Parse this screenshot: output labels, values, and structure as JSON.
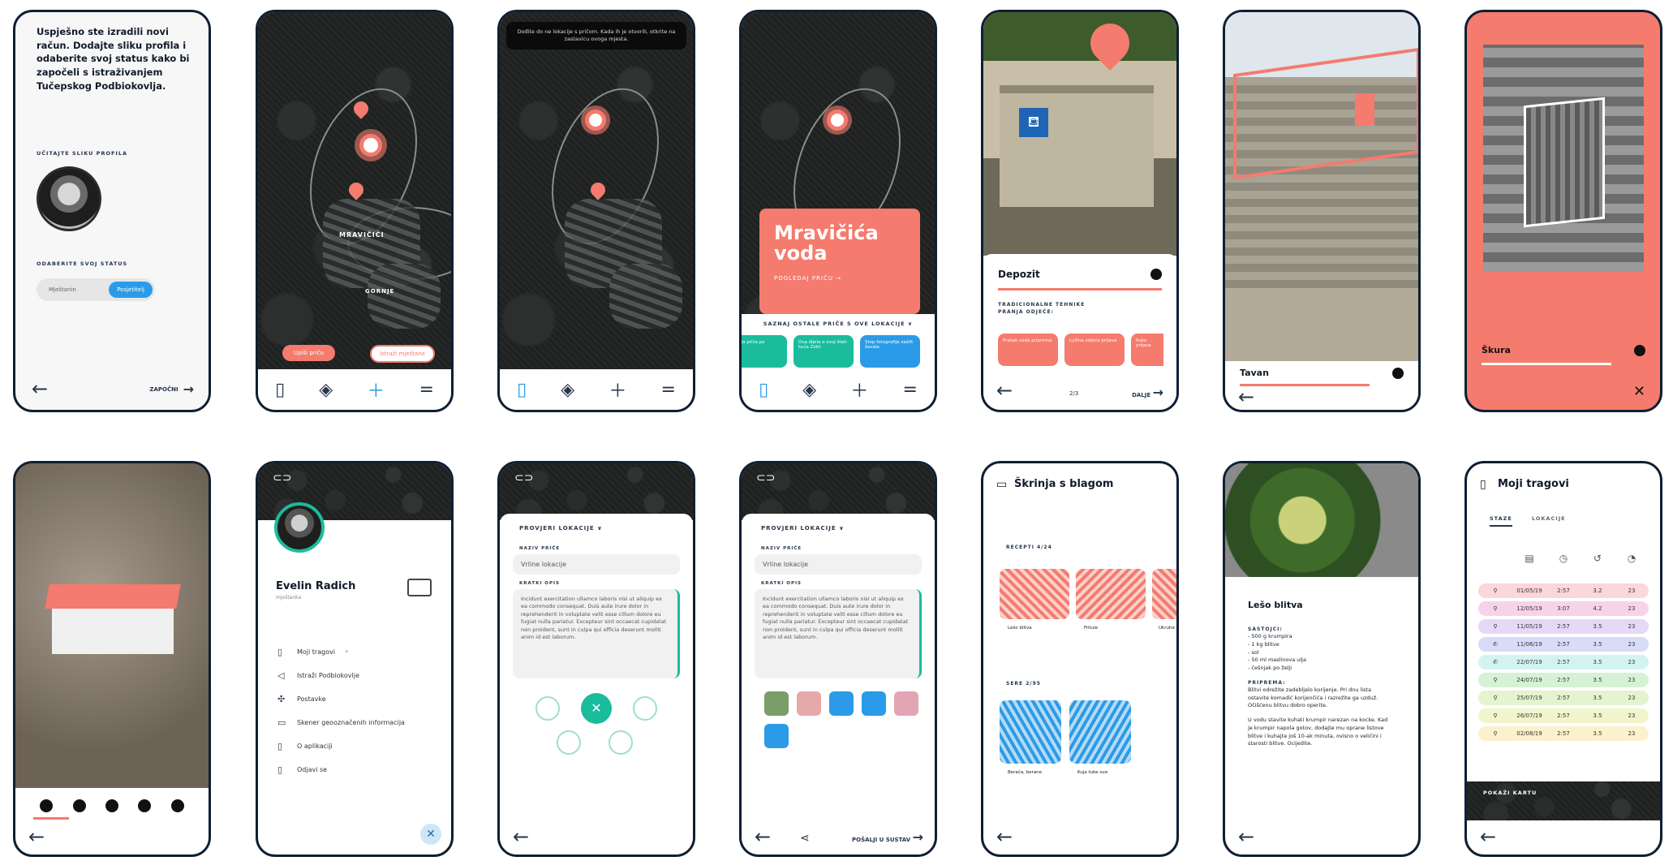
{
  "screen1": {
    "message": "Uspješno ste izradili novi račun. Dodajte sliku profila i odaberite svoj status kako bi započeli s istraživanjem Tučepskog Podbiokovlja.",
    "upload_label": "UČITAJTE SLIKU PROFILA",
    "status_label": "ODABERITE SVOJ STATUS",
    "status_options": [
      "Mještanin",
      "Posjetitelj"
    ],
    "start_label": "ZAPOČNI"
  },
  "screen2": {
    "village_label": "MRAVIČIĆI",
    "village2_label": "GORNJE",
    "btn_story": "Upiši priču",
    "btn_explore": "Istraži mještane"
  },
  "screen3": {
    "hint": "Dođite do ne lokacije s pričom. Kada ih je otvorili, otkrite na zastavicu ovoga mjesta."
  },
  "screen4": {
    "card_title": "Mravičića voda",
    "card_link": "POGLEDAJ PRIČU",
    "more_label": "SAZNAJ OSTALE PRIČE S OVE LOKACIJE",
    "stories": [
      "Cruda priča po",
      "Dva dijela o ovoj šteti kuća Zidić",
      "Stop fotografije zaštit žavala"
    ]
  },
  "screen5": {
    "title": "Depozit",
    "subtitle": "TRADICIONALNE TEHNIKE PRANJA ODJEĆE:",
    "cards": [
      "Prašak voda priprema",
      "Lužina odjeća prljava",
      "Ruke prljave"
    ],
    "page": "2/3",
    "next": "DALJE"
  },
  "screen6": {
    "title": "Tavan"
  },
  "screen7": {
    "title": "Škura"
  },
  "screen9": {
    "name": "Evelin Radich",
    "role": "mještanka",
    "menu": [
      "Moji tragovi",
      "Istraži Podbiokovlje",
      "Postavke",
      "Skener geooznačenih informacija",
      "O aplikaciji",
      "Odjavi se"
    ]
  },
  "screen10": {
    "dropdown": "PROVJERI LOKACIJE",
    "title_label": "NAZIV PRIČE",
    "title_value": "Vrline lokacije",
    "desc_label": "KRATKI OPIS",
    "desc_value": "Incidunt exercitation ullamco laboris nisi ut aliquip ex ea commodo consequat. Duis aute irure dolor in reprehenderit in voluptate velit esse cillum dolore eu fugiat nulla pariatur. Excepteur sint occaecat cupidatat non proident, sunt in culpa qui officia deserunt mollit anim id est laborum."
  },
  "screen11": {
    "dropdown": "PROVJERI LOKACIJE",
    "title_label": "NAZIV PRIČE",
    "title_value": "Vrline lokacije",
    "desc_label": "KRATKI OPIS",
    "desc_value": "Incidunt exercitation ullamco laboris nisi ut aliquip ex ea commodo consequat. Duis aute irure dolor in reprehenderit in voluptate velit esse cillum dolore eu fugiat nulla pariatur. Excepteur sint occaecat cupidatat non proident, sunt in culpa qui officia deserunt mollit anim id est laborum.",
    "send": "POŠALJI U SUSTAV"
  },
  "screen12": {
    "title": "Škrinja s blagom",
    "recipes_label": "RECEPTI 4/24",
    "recipes": [
      "Lešo blitva",
      "Fritule",
      "Ukruhe"
    ],
    "photos_label": "SERE 2/95",
    "photos": [
      "Berača, berane",
      "Kuja tuke ove"
    ]
  },
  "screen13": {
    "title": "Lešo blitva",
    "ingredients_label": "SASTOJCI:",
    "ingredients": [
      "- 500 g krumpira",
      "- 1 kg blitve",
      "- sol",
      "- 50 ml maslinova ulja",
      "- češnjak po želji"
    ],
    "prep_label": "PRIPREMA:",
    "prep1": "Blitvi odrežite zadebljalo korijenje. Pri dnu lista ostavite komadić korijenčića i razrežite ga uzduž. Očišćenu blitvu dobro operite.",
    "prep2": "U vodu stavite kuhati krumpir narezan na kocke. Kad je krumpir napola gotov, dodajte mu oprane listove blitve i kuhajte još 10-ak minuta, ovisno o veličini i starosti blitve. Ocijedite."
  },
  "screen14": {
    "title": "Moji tragovi",
    "tabs": [
      "STAZE",
      "LOKACIJE"
    ],
    "rows": [
      [
        "01/05/19",
        "2:57",
        "3.2",
        "23"
      ],
      [
        "12/05/19",
        "3:07",
        "4.2",
        "23"
      ],
      [
        "11/05/19",
        "2:57",
        "3.5",
        "23"
      ],
      [
        "11/06/19",
        "2:57",
        "3.5",
        "23"
      ],
      [
        "22/07/19",
        "2:57",
        "3.5",
        "23"
      ],
      [
        "24/07/19",
        "2:57",
        "3.5",
        "23"
      ],
      [
        "25/07/19",
        "2:57",
        "3.5",
        "23"
      ],
      [
        "26/07/19",
        "2:57",
        "3.5",
        "23"
      ],
      [
        "02/08/19",
        "2:57",
        "3.5",
        "23"
      ]
    ],
    "show_map": "POKAŽI KARTU"
  },
  "colors": {
    "coral": "#f47b6e",
    "teal": "#1abc9c",
    "blue": "#2b9be8",
    "navy": "#0f1f33"
  }
}
